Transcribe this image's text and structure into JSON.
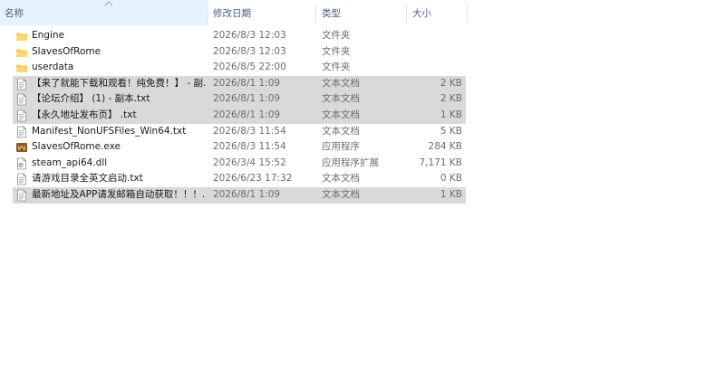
{
  "columns": {
    "name": "名称",
    "modified": "修改日期",
    "type": "类型",
    "size": "大小"
  },
  "files": [
    {
      "name": "Engine",
      "date": "2026/8/3 12:03",
      "type": "文件夹",
      "size": "",
      "icon": "folder-icon",
      "selected": false
    },
    {
      "name": "SlavesOfRome",
      "date": "2026/8/3 12:03",
      "type": "文件夹",
      "size": "",
      "icon": "folder-icon",
      "selected": false
    },
    {
      "name": "userdata",
      "date": "2026/8/5 22:00",
      "type": "文件夹",
      "size": "",
      "icon": "folder-icon",
      "selected": false
    },
    {
      "name": "【来了就能下载和观看！纯免费！】 - 副...",
      "date": "2026/8/1 1:09",
      "type": "文本文档",
      "size": "2 KB",
      "icon": "text-file-icon",
      "selected": true
    },
    {
      "name": "【论坛介绍】 (1) - 副本.txt",
      "date": "2026/8/1 1:09",
      "type": "文本文档",
      "size": "2 KB",
      "icon": "text-file-icon",
      "selected": true
    },
    {
      "name": "【永久地址发布页】 .txt",
      "date": "2026/8/1 1:09",
      "type": "文本文档",
      "size": "1 KB",
      "icon": "text-file-icon",
      "selected": true
    },
    {
      "name": "Manifest_NonUFSFiles_Win64.txt",
      "date": "2026/8/3 11:54",
      "type": "文本文档",
      "size": "5 KB",
      "icon": "text-file-icon",
      "selected": false
    },
    {
      "name": "SlavesOfRome.exe",
      "date": "2026/8/3 11:54",
      "type": "应用程序",
      "size": "284 KB",
      "icon": "app-icon",
      "selected": false
    },
    {
      "name": "steam_api64.dll",
      "date": "2026/3/4 15:52",
      "type": "应用程序扩展",
      "size": "7,171 KB",
      "icon": "dll-file-icon",
      "selected": false
    },
    {
      "name": "请游戏目录全英文启动.txt",
      "date": "2026/6/23 17:32",
      "type": "文本文档",
      "size": "0 KB",
      "icon": "text-file-icon",
      "selected": false
    },
    {
      "name": "最新地址及APP请发邮箱自动获取！！！...",
      "date": "2026/8/1 1:09",
      "type": "文本文档",
      "size": "1 KB",
      "icon": "text-file-icon",
      "selected": true
    }
  ],
  "colors": {
    "selection": "#d9d9d9",
    "header_text": "#4c607a",
    "folder": "#f5c143"
  }
}
